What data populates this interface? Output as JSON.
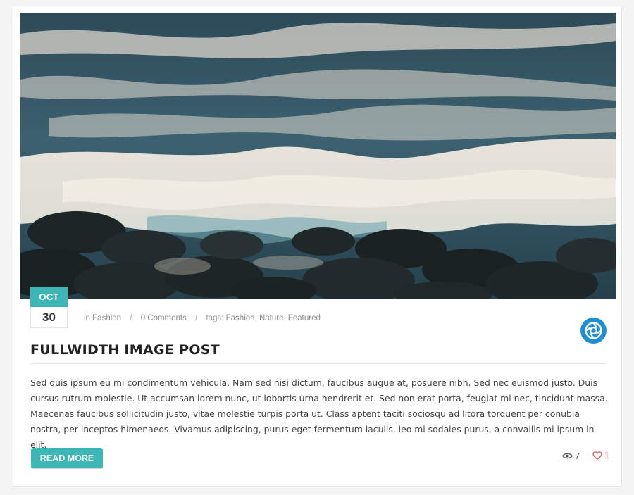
{
  "post": {
    "date": {
      "month": "OCT",
      "day": "30"
    },
    "meta": {
      "prefix": "in",
      "category": "Fashion",
      "comments": "0 Comments",
      "tags_label": "tags:",
      "tags": [
        "Fashion",
        "Nature",
        "Featured"
      ]
    },
    "title": "FULLWIDTH IMAGE POST",
    "excerpt": "Sed quis ipsum eu mi condimentum vehicula. Nam sed nisi dictum, faucibus augue at, posuere nibh. Sed nec euismod justo. Duis cursus rutrum molestie. Ut accumsan lorem nunc, ut lobortis urna hendrerit et. Sed non erat porta, feugiat mi nec, tincidunt massa. Maecenas faucibus sollicitudin justo, vitae molestie turpis porta ut. Class aptent taciti sociosqu ad litora torquent per conubia nostra, per inceptos himenaeos. Vivamus adipiscing, purus eget fermentum iaculis, leo mi sodales purus, a convallis mi ipsum in elit.",
    "read_more_label": "READ MORE",
    "views": "7",
    "likes": "1",
    "format_icon": "image-format-icon",
    "hero_icon": "ocean-waves-photo"
  },
  "colors": {
    "accent": "#3fb6b6",
    "format_icon": "#1e8fd6",
    "like": "#e84c4c"
  }
}
